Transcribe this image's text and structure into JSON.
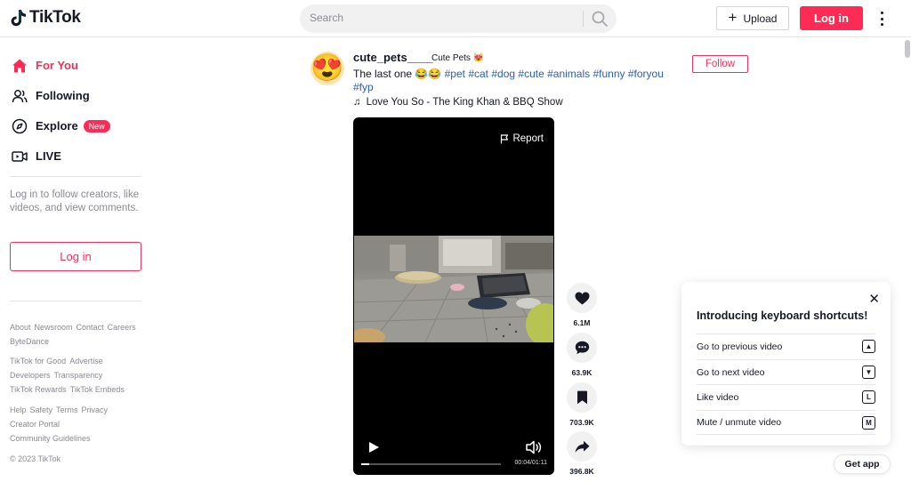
{
  "app": {
    "name": "TikTok",
    "accent_color": "#fe2c55"
  },
  "header": {
    "search_placeholder": "Search",
    "upload_label": "Upload",
    "login_label": "Log in"
  },
  "sidebar": {
    "items": [
      {
        "label": "For You",
        "icon": "home-icon",
        "active": true
      },
      {
        "label": "Following",
        "icon": "users-icon"
      },
      {
        "label": "Explore",
        "icon": "compass-icon",
        "badge": "New"
      },
      {
        "label": "LIVE",
        "icon": "live-icon"
      }
    ],
    "login_prompt": "Log in to follow creators, like videos, and view comments.",
    "login_label": "Log in",
    "footer": {
      "group1": [
        "About",
        "Newsroom",
        "Contact",
        "Careers",
        "ByteDance"
      ],
      "group2": [
        "TikTok for Good",
        "Advertise",
        "Developers",
        "Transparency",
        "TikTok Rewards",
        "TikTok Embeds"
      ],
      "group3": [
        "Help",
        "Safety",
        "Terms",
        "Privacy",
        "Creator Portal",
        "Community Guidelines"
      ],
      "copyright": "© 2023 TikTok"
    }
  },
  "post": {
    "username": "cute_pets____",
    "nickname": "Cute  Pets 😻",
    "avatar_emoji": "😍",
    "caption_text": "The last one 😂😂",
    "hashtags": [
      "#pet",
      "#cat",
      "#dog",
      "#cute",
      "#animals",
      "#funny",
      "#foryou",
      "#fyp"
    ],
    "music": "Love You So - The King Khan & BBQ Show",
    "follow_label": "Follow",
    "video": {
      "report_label": "Report",
      "time": "00:04/01:11",
      "progress": 0.06
    },
    "actions": [
      {
        "name": "like",
        "icon": "heart-icon",
        "count": "6.1M"
      },
      {
        "name": "comment",
        "icon": "comment-icon",
        "count": "63.9K"
      },
      {
        "name": "save",
        "icon": "bookmark-icon",
        "count": "703.9K"
      },
      {
        "name": "share",
        "icon": "share-icon",
        "count": "396.8K"
      }
    ]
  },
  "shortcuts": {
    "title": "Introducing keyboard shortcuts!",
    "rows": [
      {
        "label": "Go to previous video",
        "key": "▲"
      },
      {
        "label": "Go to next video",
        "key": "▼"
      },
      {
        "label": "Like video",
        "key": "L"
      },
      {
        "label": "Mute / unmute video",
        "key": "M"
      }
    ]
  },
  "get_app_label": "Get app"
}
